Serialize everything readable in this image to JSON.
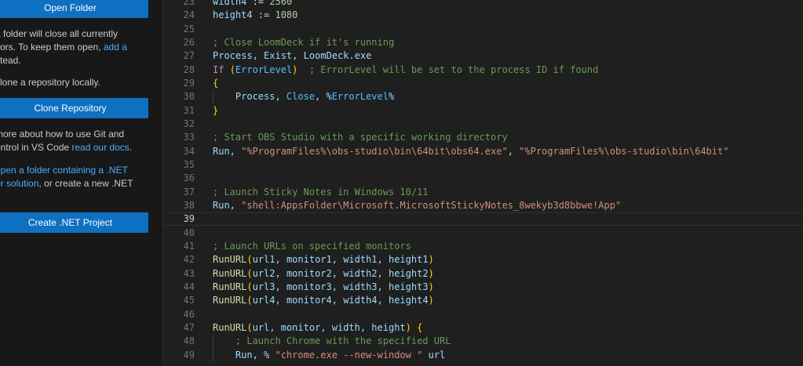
{
  "sidebar": {
    "open_folder_label": "Open Folder",
    "close_note_lines": [
      "a folder will close all currently",
      "itors. To keep them open, ",
      "stead."
    ],
    "add_link": "add a",
    "clone_note": "clone a repository locally.",
    "clone_repository_label": "Clone Repository",
    "git_note_lines": [
      "more about how to use Git and",
      "ontrol in VS Code "
    ],
    "docs_link": "read our docs",
    "docs_suffix": ".",
    "dotnet_link_lines": [
      "open a folder containing a .NET",
      "or solution"
    ],
    "dotnet_suffix": ", or create a new .NET",
    "create_dotnet_label": "Create .NET Project"
  },
  "editor": {
    "current_line": 39,
    "lines": [
      {
        "n": "23",
        "t": [
          [
            "width4",
            "v"
          ],
          [
            " := ",
            "o"
          ],
          [
            "2560",
            "n"
          ]
        ]
      },
      {
        "n": "24",
        "t": [
          [
            "height4",
            "v"
          ],
          [
            " := ",
            "o"
          ],
          [
            "1080",
            "n"
          ]
        ]
      },
      {
        "n": "25",
        "t": []
      },
      {
        "n": "26",
        "t": [
          [
            "; Close LoomDeck if it's running",
            "c"
          ]
        ]
      },
      {
        "n": "27",
        "t": [
          [
            "Process, Exist, LoomDeck.exe",
            "v"
          ]
        ]
      },
      {
        "n": "28",
        "t": [
          [
            "If ",
            "kw"
          ],
          [
            "(",
            "p1"
          ],
          [
            "ErrorLevel",
            "bi"
          ],
          [
            ")",
            "p1"
          ],
          [
            "  ; ErrorLevel will be set to the process ID if found",
            "c"
          ]
        ]
      },
      {
        "n": "29",
        "t": [
          [
            "{",
            "p1"
          ]
        ]
      },
      {
        "n": "30",
        "guide": true,
        "t": [
          [
            "    Process, ",
            "v"
          ],
          [
            "Close",
            "bi"
          ],
          [
            ", %",
            "v"
          ],
          [
            "ErrorLevel",
            "bi"
          ],
          [
            "%",
            "v"
          ]
        ]
      },
      {
        "n": "31",
        "t": [
          [
            "}",
            "p1"
          ]
        ]
      },
      {
        "n": "32",
        "t": []
      },
      {
        "n": "33",
        "t": [
          [
            "; Start OBS Studio with a specific working directory",
            "c"
          ]
        ]
      },
      {
        "n": "34",
        "t": [
          [
            "Run, ",
            "v"
          ],
          [
            "\"%ProgramFiles%\\obs-studio\\bin\\64bit\\obs64.exe\"",
            "s"
          ],
          [
            ", ",
            "o"
          ],
          [
            "\"%ProgramFiles%\\obs-studio\\bin\\64bit\"",
            "s"
          ]
        ]
      },
      {
        "n": "35",
        "t": []
      },
      {
        "n": "36",
        "t": []
      },
      {
        "n": "37",
        "t": [
          [
            "; Launch Sticky Notes in Windows 10/11",
            "c"
          ]
        ]
      },
      {
        "n": "38",
        "t": [
          [
            "Run, ",
            "v"
          ],
          [
            "\"shell:AppsFolder\\Microsoft.MicrosoftStickyNotes_8wekyb3d8bbwe!App\"",
            "s"
          ]
        ]
      },
      {
        "n": "39",
        "t": []
      },
      {
        "n": "40",
        "t": []
      },
      {
        "n": "41",
        "t": [
          [
            "; Launch URLs on specified monitors",
            "c"
          ]
        ]
      },
      {
        "n": "42",
        "t": [
          [
            "RunURL",
            "fn"
          ],
          [
            "(",
            "p1"
          ],
          [
            "url1, monitor1, width1, height1",
            "v"
          ],
          [
            ")",
            "p1"
          ]
        ]
      },
      {
        "n": "43",
        "t": [
          [
            "RunURL",
            "fn"
          ],
          [
            "(",
            "p1"
          ],
          [
            "url2, monitor2, width2, height2",
            "v"
          ],
          [
            ")",
            "p1"
          ]
        ]
      },
      {
        "n": "44",
        "t": [
          [
            "RunURL",
            "fn"
          ],
          [
            "(",
            "p1"
          ],
          [
            "url3, monitor3, width3, height3",
            "v"
          ],
          [
            ")",
            "p1"
          ]
        ]
      },
      {
        "n": "45",
        "t": [
          [
            "RunURL",
            "fn"
          ],
          [
            "(",
            "p1"
          ],
          [
            "url4, monitor4, width4, height4",
            "v"
          ],
          [
            ")",
            "p1"
          ]
        ]
      },
      {
        "n": "46",
        "t": []
      },
      {
        "n": "47",
        "t": [
          [
            "RunURL",
            "fn"
          ],
          [
            "(",
            "p1"
          ],
          [
            "url, monitor, width, height",
            "v"
          ],
          [
            ")",
            "p1"
          ],
          [
            " ",
            "o"
          ],
          [
            "{",
            "p1"
          ]
        ]
      },
      {
        "n": "48",
        "guide": true,
        "t": [
          [
            "    ; Launch Chrome with the specified URL",
            "c"
          ]
        ]
      },
      {
        "n": "49",
        "guide": true,
        "t": [
          [
            "    Run, % ",
            "v"
          ],
          [
            "\"chrome.exe --new-window \"",
            "s"
          ],
          [
            " url",
            "v"
          ]
        ]
      }
    ]
  },
  "colors": {
    "button": "#0e70c0",
    "link": "#4daafc",
    "comment": "#6a9955",
    "string": "#ce9178",
    "number": "#b5cea8",
    "keyword": "#c586c0",
    "function": "#dcdcaa",
    "variable": "#9cdcfe",
    "bracket": "#ffd700"
  }
}
